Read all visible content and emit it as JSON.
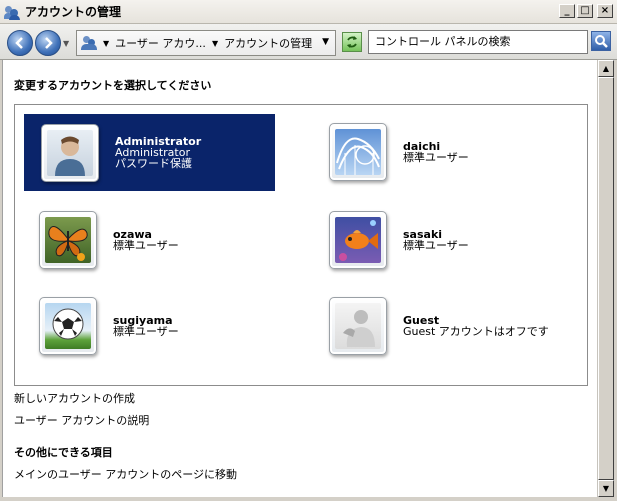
{
  "window": {
    "title": "アカウントの管理",
    "minimize_label": "_",
    "maximize_label": "□",
    "close_label": "×"
  },
  "toolbar": {
    "breadcrumb": [
      "ユーザー アカウ...",
      "アカウントの管理"
    ],
    "search_placeholder": "コントロール パネルの検索",
    "refresh_icon": "refresh-icon",
    "search_icon": "search-icon"
  },
  "main": {
    "heading": "変更するアカウントを選択してください",
    "accounts": [
      {
        "name": "Administrator",
        "line1": "Administrator",
        "line2": "パスワード保護",
        "selected": true,
        "picture": "generic-user"
      },
      {
        "name": "daichi",
        "line1": "標準ユーザー",
        "line2": "",
        "selected": false,
        "picture": "roller-coaster"
      },
      {
        "name": "ozawa",
        "line1": "標準ユーザー",
        "line2": "",
        "selected": false,
        "picture": "butterfly"
      },
      {
        "name": "sasaki",
        "line1": "標準ユーザー",
        "line2": "",
        "selected": false,
        "picture": "fish"
      },
      {
        "name": "sugiyama",
        "line1": "標準ユーザー",
        "line2": "",
        "selected": false,
        "picture": "soccer-ball"
      },
      {
        "name": "Guest",
        "line1": "Guest アカウントはオフです",
        "line2": "",
        "selected": false,
        "picture": "guest-user"
      }
    ],
    "links": [
      "新しいアカウントの作成",
      "ユーザー アカウントの説明"
    ],
    "other_heading": "その他にできる項目",
    "other_links": [
      "メインのユーザー アカウントのページに移動"
    ]
  },
  "colors": {
    "selection": "#0a246a",
    "window_bg": "#d4d0c8"
  }
}
